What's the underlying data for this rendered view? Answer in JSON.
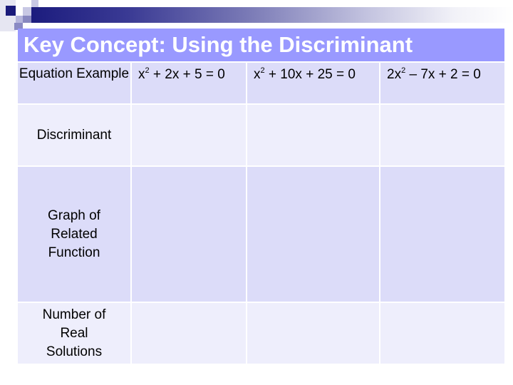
{
  "slide": {
    "title": "Key Concept: Using the Discriminant",
    "colors": {
      "title_bg": "#9999ff",
      "title_text": "#ffffff",
      "header_bar_dark": "#1c1c7e",
      "row_dark": "#dcdcf9",
      "row_light": "#eeeefc"
    }
  },
  "table": {
    "rows": [
      {
        "header": "Equation Example",
        "cells": [
          {
            "pre": "x",
            "sup": "2",
            "post": " + 2x + 5 = 0"
          },
          {
            "pre": "x",
            "sup": "2",
            "post": " + 10x + 25 = 0"
          },
          {
            "pre": "2x",
            "sup": "2",
            "post": " – 7x + 2 = 0"
          }
        ]
      },
      {
        "header": "Discriminant",
        "cells": [
          "",
          "",
          ""
        ]
      },
      {
        "header": "Graph of Related Function",
        "cells": [
          "",
          "",
          ""
        ]
      },
      {
        "header": "Number of Real Solutions",
        "cells": [
          "",
          "",
          ""
        ]
      }
    ]
  }
}
